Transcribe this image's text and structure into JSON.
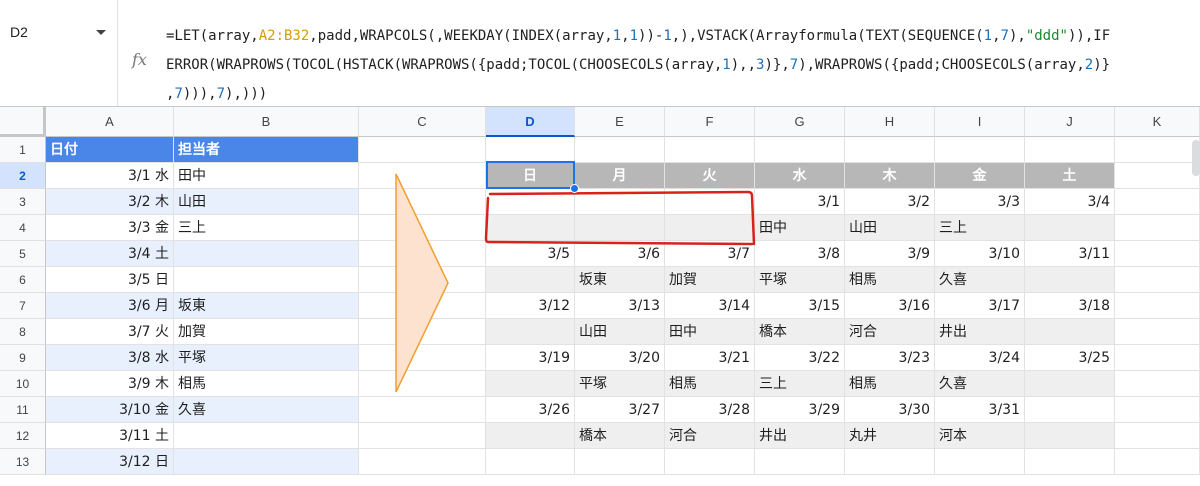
{
  "name_box": {
    "ref": "D2"
  },
  "formula_bar": {
    "fx_icon": "fx",
    "lines": [
      [
        [
          "=LET(array,",
          ""
        ],
        [
          "A2:B32",
          "ref"
        ],
        [
          ",padd,WRAPCOLS(,WEEKDAY(INDEX(array,",
          ""
        ],
        [
          "1",
          "num"
        ],
        [
          ",",
          ""
        ],
        [
          "1",
          "num"
        ],
        [
          "))-",
          ""
        ],
        [
          "1",
          "num"
        ],
        [
          ",),VSTACK(Arrayformula(TEXT(SEQUENCE(",
          ""
        ],
        [
          "1",
          "num"
        ],
        [
          ",",
          ""
        ],
        [
          "7",
          "num"
        ],
        [
          "),",
          ""
        ],
        [
          "\"ddd\"",
          "str"
        ],
        [
          ")),IF",
          ""
        ]
      ],
      [
        [
          "ERROR(WRAPROWS(TOCOL(HSTACK(WRAPROWS({padd;TOCOL(CHOOSECOLS(array,",
          ""
        ],
        [
          "1",
          "num"
        ],
        [
          "),,",
          ""
        ],
        [
          "3",
          "num"
        ],
        [
          ")},",
          ""
        ],
        [
          "7",
          "num"
        ],
        [
          "),WRAPROWS({padd;CHOOSECOLS(array,",
          ""
        ],
        [
          "2",
          "num"
        ],
        [
          ")}",
          ""
        ]
      ],
      [
        [
          ",",
          ""
        ],
        [
          "7",
          "num"
        ],
        [
          "))),",
          ""
        ],
        [
          "7",
          "num"
        ],
        [
          "),)))",
          ""
        ]
      ]
    ]
  },
  "columns": [
    "A",
    "B",
    "C",
    "D",
    "E",
    "F",
    "G",
    "H",
    "I",
    "J",
    "K"
  ],
  "selected_column": "D",
  "rows": [
    1,
    2,
    3,
    4,
    5,
    6,
    7,
    8,
    9,
    10,
    11,
    12,
    13
  ],
  "selected_row": 2,
  "source_table": {
    "headers": [
      "日付",
      "担当者"
    ],
    "dates": [
      "3/1 水",
      "3/2 木",
      "3/3 金",
      "3/4 土",
      "3/5 日",
      "3/6 月",
      "3/7 火",
      "3/8 水",
      "3/9 木",
      "3/10 金",
      "3/11 土",
      "3/12 日"
    ],
    "names": [
      "田中",
      "山田",
      "三上",
      "",
      "",
      "坂東",
      "加賀",
      "平塚",
      "相馬",
      "久喜",
      "",
      ""
    ]
  },
  "calendar": {
    "weekdays": [
      "日",
      "月",
      "火",
      "水",
      "木",
      "金",
      "土"
    ],
    "rows": [
      [
        "",
        "",
        "",
        "3/1",
        "3/2",
        "3/3",
        "3/4"
      ],
      [
        "",
        "",
        "",
        "田中",
        "山田",
        "三上",
        ""
      ],
      [
        "3/5",
        "3/6",
        "3/7",
        "3/8",
        "3/9",
        "3/10",
        "3/11"
      ],
      [
        "",
        "坂東",
        "加賀",
        "平塚",
        "相馬",
        "久喜",
        ""
      ],
      [
        "3/12",
        "3/13",
        "3/14",
        "3/15",
        "3/16",
        "3/17",
        "3/18"
      ],
      [
        "",
        "山田",
        "田中",
        "橋本",
        "河合",
        "井出",
        ""
      ],
      [
        "3/19",
        "3/20",
        "3/21",
        "3/22",
        "3/23",
        "3/24",
        "3/25"
      ],
      [
        "",
        "平塚",
        "相馬",
        "三上",
        "相馬",
        "久喜",
        ""
      ],
      [
        "3/26",
        "3/27",
        "3/28",
        "3/29",
        "3/30",
        "3/31",
        ""
      ],
      [
        "",
        "橋本",
        "河合",
        "井出",
        "丸井",
        "河本",
        ""
      ]
    ]
  },
  "colors": {
    "accent_blue": "#4a86e8",
    "weekday_header_gray": "#b7b7b7",
    "highlight_red": "#d9221c",
    "arrow_fill": "#fde3cf",
    "arrow_stroke": "#f0a030"
  }
}
